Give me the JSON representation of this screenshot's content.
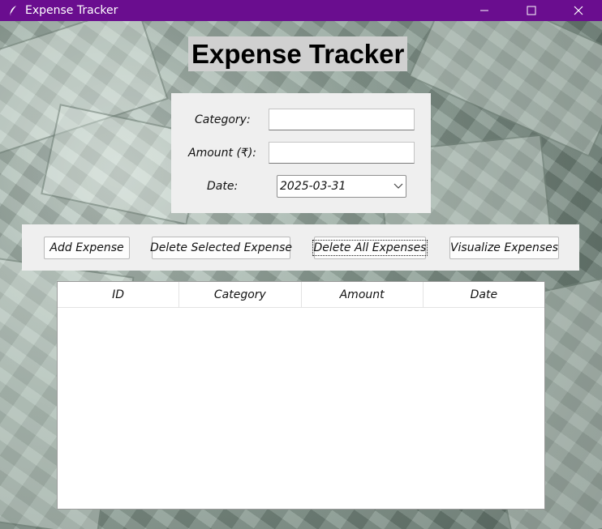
{
  "window": {
    "title": "Expense Tracker",
    "titlebar_color": "#6a0d8f",
    "app_icon": "feather-icon",
    "controls": [
      "minimize-icon",
      "maximize-icon",
      "close-icon"
    ]
  },
  "header": {
    "title": "Expense Tracker",
    "background": "#d0d0d0"
  },
  "form": {
    "category_label": "Category:",
    "category_value": "",
    "amount_label": "Amount (₹):",
    "amount_value": "",
    "date_label": "Date:",
    "date_value": "2025-03-31"
  },
  "buttons": {
    "add": "Add Expense",
    "delete_selected": "Delete Selected Expense",
    "delete_all": "Delete All Expenses",
    "visualize": "Visualize Expenses"
  },
  "table": {
    "columns": [
      "ID",
      "Category",
      "Amount",
      "Date"
    ],
    "rows": []
  }
}
